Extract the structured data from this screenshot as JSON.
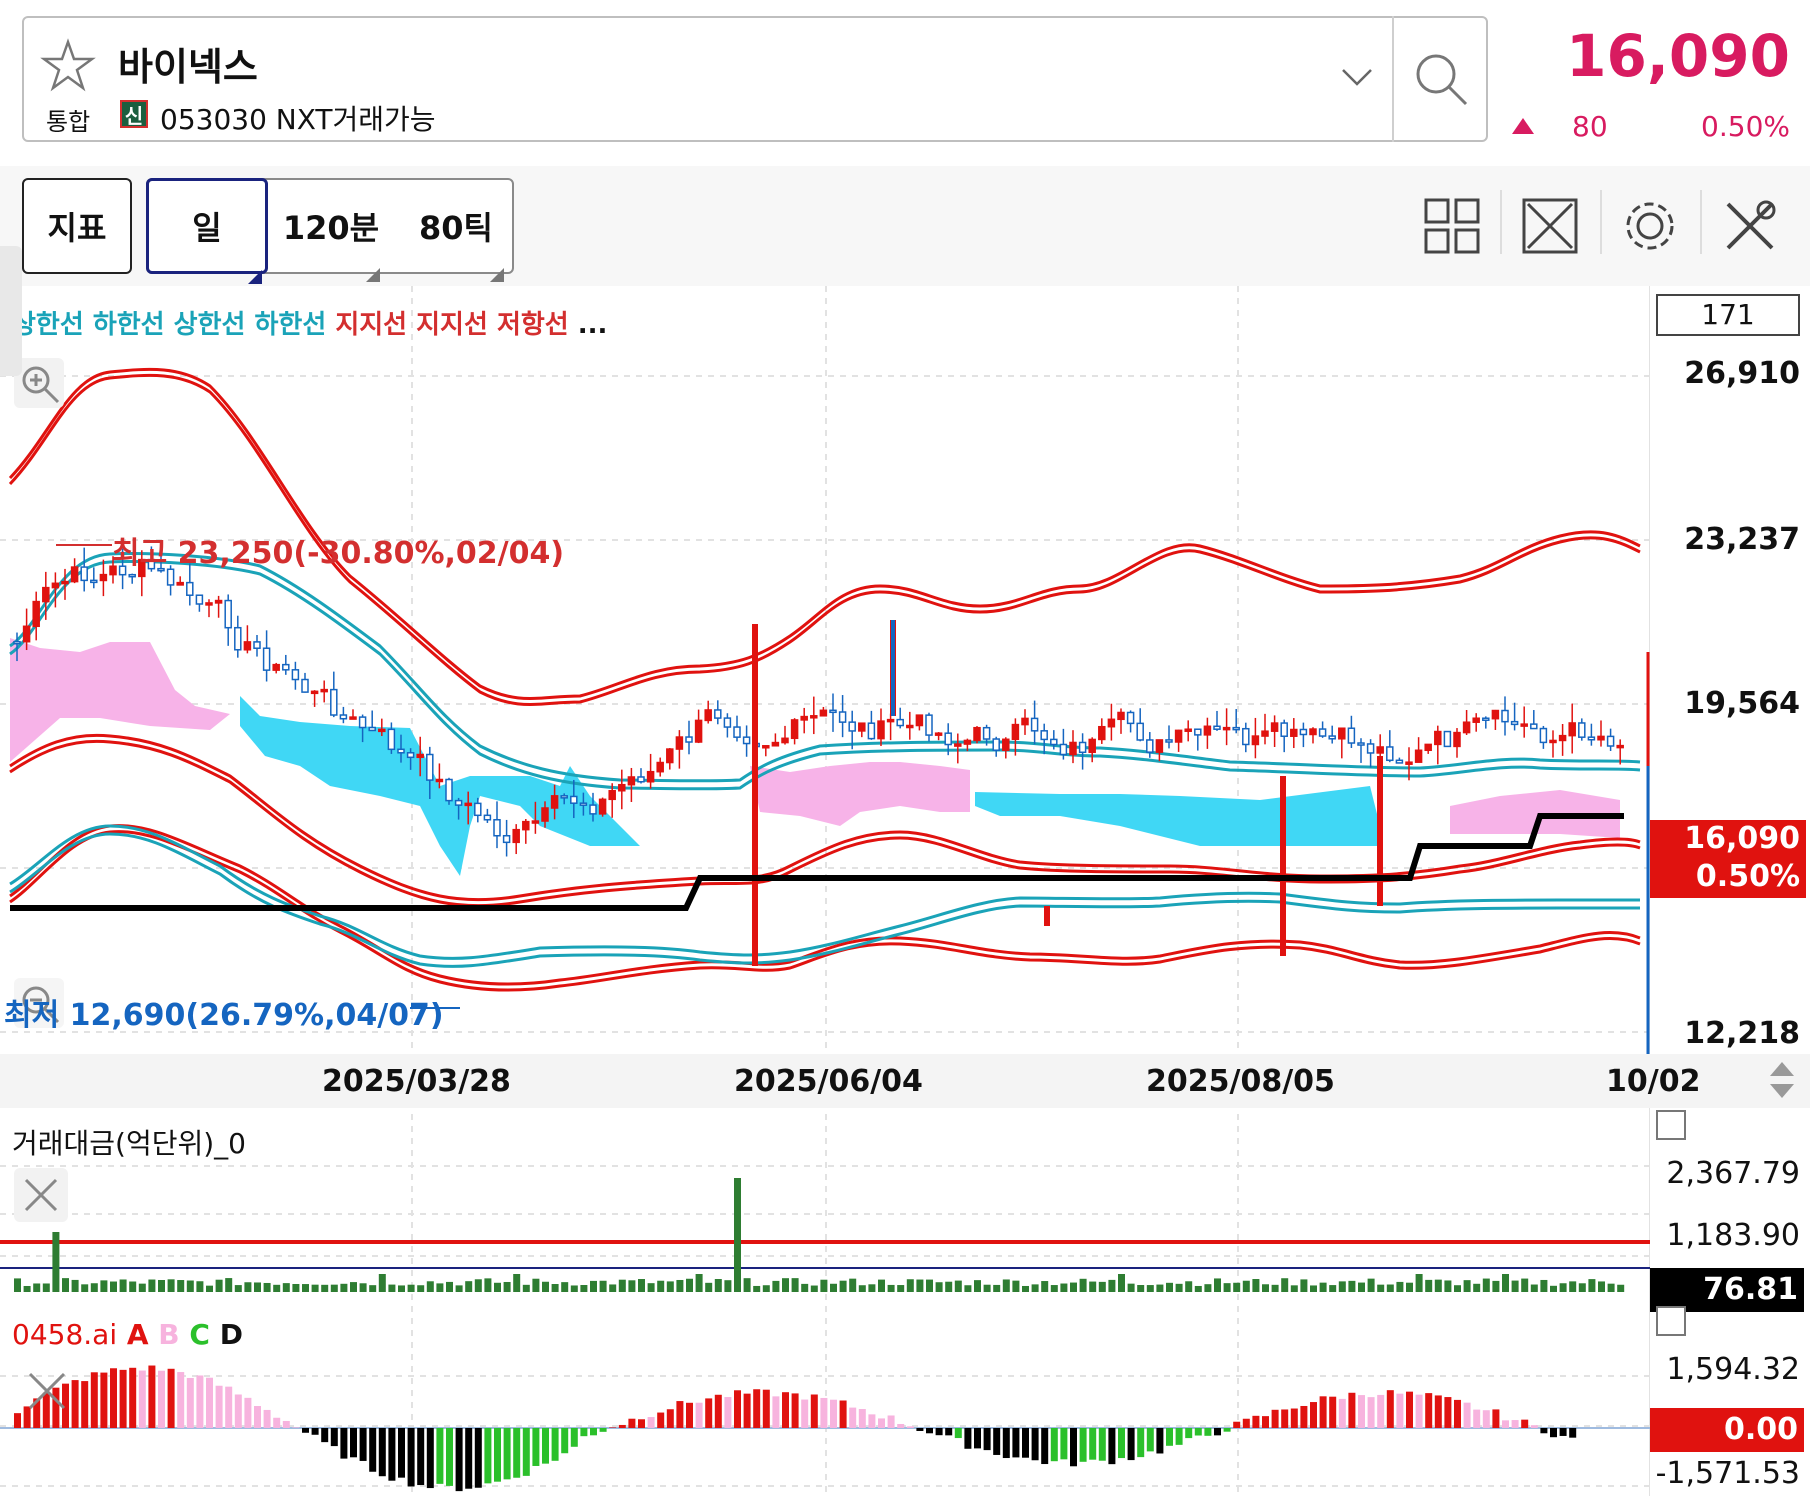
{
  "header": {
    "stock_name": "바이넥스",
    "market": "통합",
    "credit_badge": "신",
    "code_info": "053030 NXT거래가능",
    "price": "16,090",
    "change": "80",
    "change_pct": "0.50%"
  },
  "toolbar": {
    "indicator_label": "지표",
    "periods": [
      "일",
      "120분",
      "80틱"
    ],
    "selected_period": "일"
  },
  "chart": {
    "legend": [
      {
        "text": "상한선",
        "color": "#1aa3b8"
      },
      {
        "text": "하한선",
        "color": "#1aa3b8"
      },
      {
        "text": "상한선",
        "color": "#1aa3b8"
      },
      {
        "text": "하한선",
        "color": "#1aa3b8"
      },
      {
        "text": "지지선",
        "color": "#d32f2f"
      },
      {
        "text": "지지선",
        "color": "#d32f2f"
      },
      {
        "text": "저항선",
        "color": "#d32f2f"
      },
      {
        "text": "...",
        "color": "#111111"
      }
    ],
    "count_box": "171",
    "y_labels": [
      "26,910",
      "23,237",
      "19,564",
      "12,218"
    ],
    "dates": [
      "2025/03/28",
      "2025/06/04",
      "2025/08/05",
      "10/02"
    ],
    "high_label": "최고 23,250(-30.80%,02/04)",
    "low_label": "최저 12,690(26.79%,04/07)",
    "price_tag": {
      "price": "16,090",
      "pct": "0.50%"
    }
  },
  "volume_panel": {
    "title": "거래대금(억단위)_0",
    "y_labels": [
      "2,367.79",
      "1,183.90"
    ],
    "current": "76.81"
  },
  "indicator_panel": {
    "title_parts": [
      {
        "text": "0458.ai",
        "color": "#e0120f"
      },
      {
        "text": "A",
        "color": "#e0120f"
      },
      {
        "text": "B",
        "color": "#f7b3de"
      },
      {
        "text": "C",
        "color": "#2bc02b"
      },
      {
        "text": "D",
        "color": "#111111"
      }
    ],
    "y_labels": [
      "1,594.32",
      "-1,571.53"
    ],
    "current": "0.00"
  },
  "colors": {
    "up": "#e0120f",
    "down": "#1565c0",
    "accent": "#d81b60",
    "cloud_pink": "#f7b3e8",
    "cloud_cyan": "#40d7f5",
    "band_teal": "#1aa3b8"
  }
}
